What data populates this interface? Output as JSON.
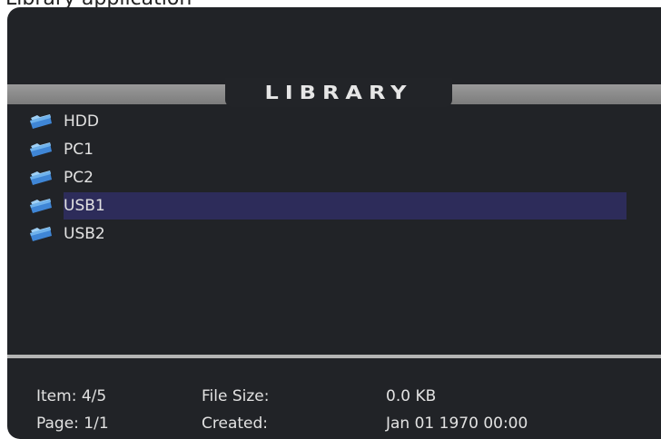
{
  "top_caption": "Library application",
  "header": {
    "title": "LIBRARY"
  },
  "list": {
    "items": [
      {
        "label": "HDD",
        "icon": "folder-icon"
      },
      {
        "label": "PC1",
        "icon": "folder-icon"
      },
      {
        "label": "PC2",
        "icon": "folder-icon"
      },
      {
        "label": "USB1",
        "icon": "folder-icon",
        "selected": true
      },
      {
        "label": "USB2",
        "icon": "folder-icon"
      }
    ],
    "selected_index": 3
  },
  "info": {
    "item_text": "Item: 4/5",
    "page_text": "Page: 1/1",
    "file_size_label": "File Size:",
    "file_size_value": "0.0 KB",
    "created_label": "Created:",
    "created_value": "Jan 01 1970 00:00"
  },
  "colors": {
    "background": "#212327",
    "title_bar": "#8a8a8a",
    "selection": "#2d2c5a",
    "text": "#e2e2e2",
    "folder_icon": "#3f86d6"
  }
}
